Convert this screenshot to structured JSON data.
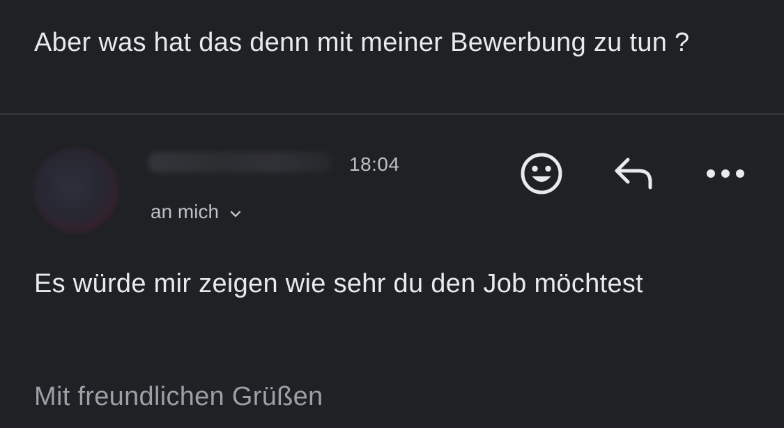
{
  "thread": {
    "previous_message": "Aber was hat das denn mit meiner Bewerbung zu tun ?"
  },
  "message": {
    "time": "18:04",
    "recipient": "an mich",
    "body": "Es würde mir zeigen wie sehr du den Job möchtest",
    "signature": "Mit freundlichen Grüßen"
  },
  "icons": {
    "emoji": "emoji-reaction-icon",
    "reply": "reply-icon",
    "more": "more-options-icon",
    "chevron": "chevron-down-icon"
  },
  "colors": {
    "background": "#202124",
    "text_primary": "#e8eaed",
    "text_secondary": "#bdc1c6",
    "text_muted": "#9aa0a6",
    "divider": "#5f6368"
  }
}
